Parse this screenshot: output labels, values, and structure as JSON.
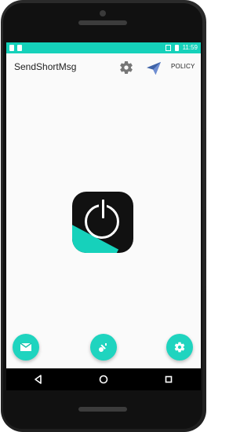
{
  "status_bar": {
    "time": "11:59",
    "icons": [
      "sim-card-icon",
      "notification-icon",
      "vibrate-icon",
      "battery-icon"
    ]
  },
  "app_bar": {
    "title": "SendShortMsg",
    "actions": {
      "settings_icon": "gear-icon",
      "send_icon": "paper-plane-icon",
      "policy_label": "POLICY"
    }
  },
  "main": {
    "center_icon": "power-icon"
  },
  "bottom_actions": [
    {
      "name": "mail-fab",
      "icon": "mail-icon"
    },
    {
      "name": "key-fab",
      "icon": "key-icon"
    },
    {
      "name": "settings-fab",
      "icon": "gear-icon"
    }
  ],
  "navigation": [
    {
      "name": "back-button",
      "icon": "back-triangle-icon"
    },
    {
      "name": "home-button",
      "icon": "home-circle-icon"
    },
    {
      "name": "recents-button",
      "icon": "recents-square-icon"
    }
  ],
  "colors": {
    "accent": "#15d1ba",
    "screen_bg": "#fafafa",
    "device_body": "#222222"
  }
}
